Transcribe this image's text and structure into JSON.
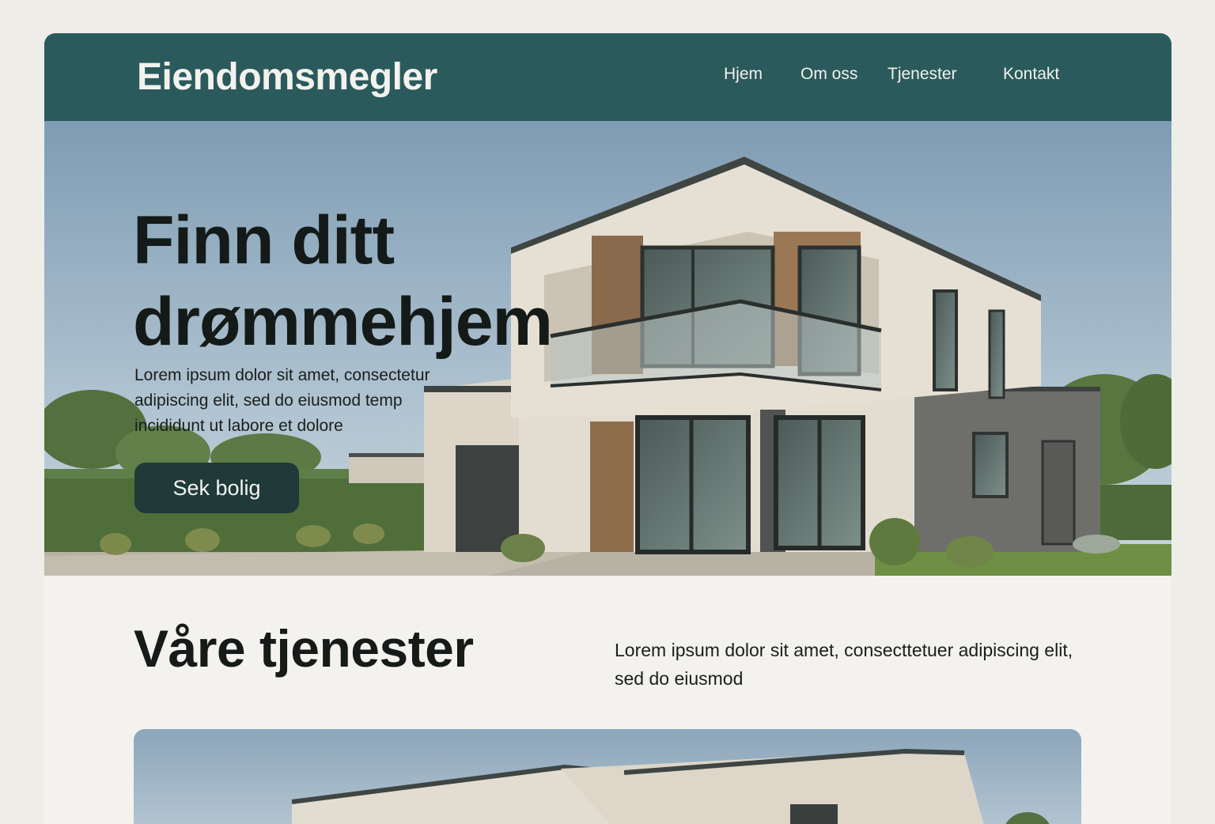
{
  "header": {
    "brand": "Eiendomsmegler",
    "nav": [
      "Hjem",
      "Om oss",
      "Tjenester",
      "Kontakt"
    ]
  },
  "hero": {
    "title_line1": "Finn ditt",
    "title_line2": "drømmehjem",
    "text": "Lorem ipsum dolor sit amet, consectetur adipiscing elit, sed do eiusmod temp incididunt ut labore et dolore",
    "button": "Sek bolig"
  },
  "services": {
    "title": "Våre tjenester",
    "text": "Lorem ipsum dolor sit amet, consecttetuer adipiscing elit, sed do eiusmod"
  },
  "colors": {
    "header_bg": "#2b5a5c",
    "button_bg": "#1f3a38",
    "page_bg": "#f4f2ee",
    "text_dark": "#141a18"
  }
}
